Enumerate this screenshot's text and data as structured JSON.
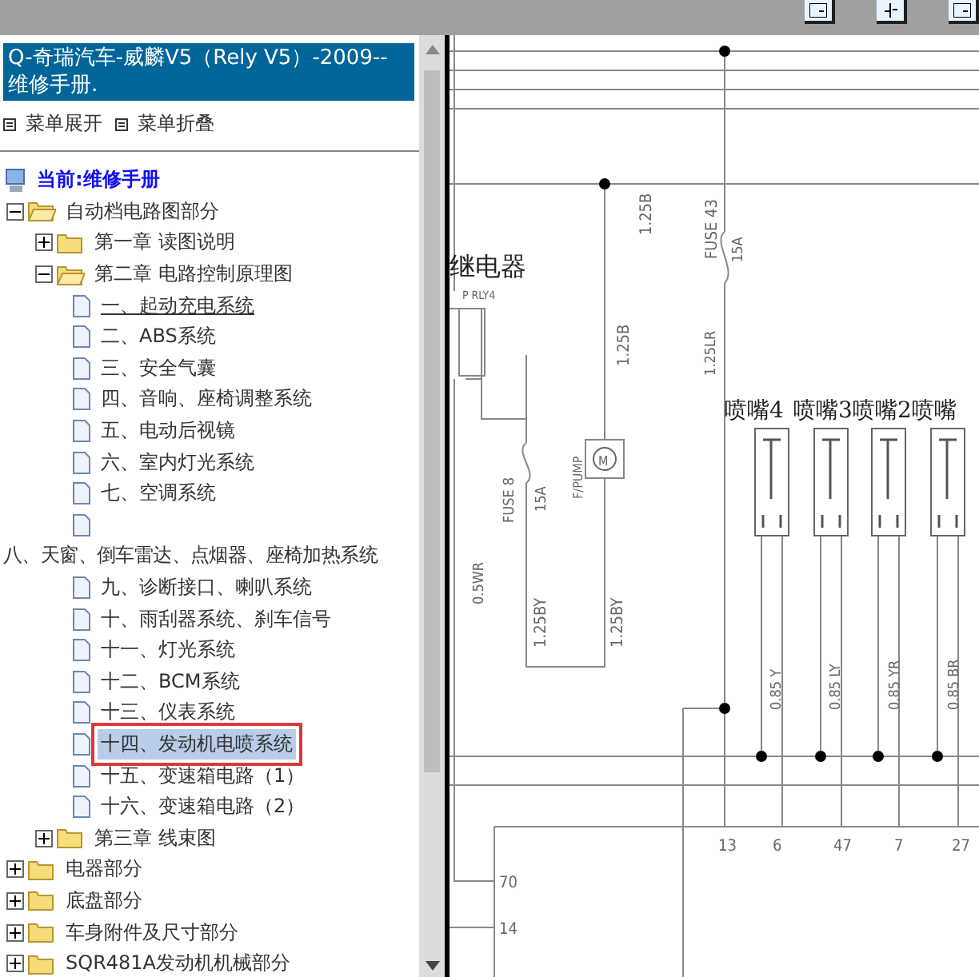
{
  "toolbar": {
    "buttons": [
      {
        "kind": "tile"
      },
      {
        "kind": "split"
      },
      {
        "kind": "tile"
      }
    ]
  },
  "sidebar": {
    "title": "Q-奇瑞汽车-威麟V5（Rely V5）-2009-- 维修手册.",
    "menu": [
      {
        "label": "菜单展开"
      },
      {
        "label": "菜单折叠"
      }
    ],
    "current": "当前:维修手册",
    "tree": [
      {
        "kind": "folder",
        "label": "自动档电路图部分",
        "expanded": true,
        "children": [
          {
            "kind": "folder",
            "label": "第一章 读图说明",
            "expanded": false
          },
          {
            "kind": "folder",
            "label": "第二章 电路控制原理图",
            "expanded": true,
            "children": [
              {
                "kind": "page",
                "label": "一、起动充电系统",
                "hovered": true,
                "selected": false
              },
              {
                "kind": "page",
                "label": "二、ABS系统",
                "hovered": false,
                "selected": false
              },
              {
                "kind": "page",
                "label": "三、安全气囊",
                "hovered": false,
                "selected": false
              },
              {
                "kind": "page",
                "label": "四、音响、座椅调整系统",
                "hovered": false,
                "selected": false
              },
              {
                "kind": "page",
                "label": "五、电动后视镜",
                "hovered": false,
                "selected": false
              },
              {
                "kind": "page",
                "label": "六、室内灯光系统",
                "hovered": false,
                "selected": false
              },
              {
                "kind": "page",
                "label": "七、空调系统",
                "hovered": false,
                "selected": false
              },
              {
                "kind": "wrapped",
                "label": "八、天窗、倒车雷达、点烟器、座椅加热系统",
                "hovered": false,
                "selected": false
              },
              {
                "kind": "page",
                "label": "九、诊断接口、喇叭系统",
                "hovered": false,
                "selected": false
              },
              {
                "kind": "page",
                "label": "十、雨刮器系统、刹车信号",
                "hovered": false,
                "selected": false
              },
              {
                "kind": "page",
                "label": "十一、灯光系统",
                "hovered": false,
                "selected": false
              },
              {
                "kind": "page",
                "label": "十二、BCM系统",
                "hovered": false,
                "selected": false
              },
              {
                "kind": "page",
                "label": "十三、仪表系统",
                "hovered": false,
                "selected": false
              },
              {
                "kind": "page",
                "label": "十四、发动机电喷系统",
                "hovered": false,
                "selected": true
              },
              {
                "kind": "page",
                "label": "十五、变速箱电路（1）",
                "hovered": false,
                "selected": false
              },
              {
                "kind": "page",
                "label": "十六、变速箱电路（2）",
                "hovered": false,
                "selected": false
              }
            ]
          },
          {
            "kind": "folder",
            "label": "第三章 线束图",
            "expanded": false
          }
        ]
      },
      {
        "kind": "folder",
        "label": "电器部分",
        "expanded": false
      },
      {
        "kind": "folder",
        "label": "底盘部分",
        "expanded": false
      },
      {
        "kind": "folder",
        "label": "车身附件及尺寸部分",
        "expanded": false
      },
      {
        "kind": "folder",
        "label": "SQR481A发动机机械部分",
        "expanded": false
      }
    ]
  },
  "diagram": {
    "labels": [
      "继电器",
      "P RLY4",
      "1.25B",
      "FUSE 43",
      "15A",
      "1.25B",
      "1.25LR",
      "喷嘴4",
      "喷嘴3",
      "喷嘴2",
      "喷嘴",
      "FUSE 8",
      "15A",
      "F/PUMP",
      "M",
      "0.5WR",
      "1.25BY",
      "1.25BY",
      "0.85 Y",
      "0.85 LY",
      "0.85 YR",
      "0.85 BR",
      "13",
      "6",
      "47",
      "7",
      "27",
      "70",
      "14"
    ]
  }
}
